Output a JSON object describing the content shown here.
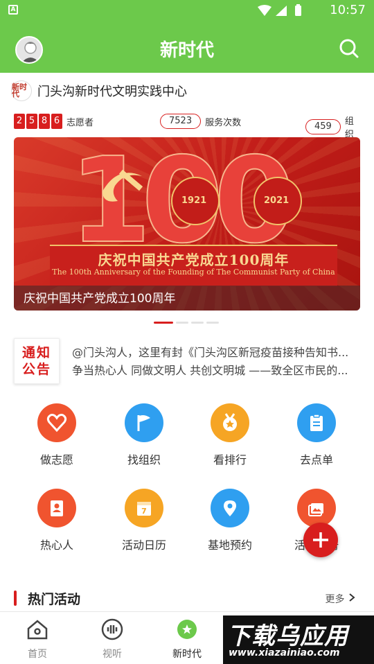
{
  "status_bar": {
    "time": "10:57"
  },
  "header": {
    "title": "新时代"
  },
  "org": {
    "name": "门头沟新时代文明实践中心",
    "logo_text": "新时代"
  },
  "stats": {
    "volunteer_digits": [
      "2",
      "5",
      "8",
      "6"
    ],
    "volunteer_label": "志愿者",
    "service_count": "7523",
    "service_label": "服务次数",
    "org_count": "459",
    "org_label": "组织"
  },
  "banner": {
    "caption": "庆祝中国共产党成立100周年",
    "image_cn": "庆祝中国共产党成立100周年",
    "image_en": "The 100th Anniversary of the Founding of The Communist Party of China",
    "year_start": "1921",
    "year_end": "2021",
    "big_number": "100",
    "slide_count": 4,
    "active_slide": 1
  },
  "notice": {
    "badge": "通知公告",
    "lines": [
      "@门头沟人，这里有封《门头沟区新冠疫苗接种告知书...",
      "争当热心人 同做文明人 共创文明城 ——致全区市民的..."
    ]
  },
  "features": [
    {
      "label": "做志愿",
      "icon": "heart-icon",
      "color": "#f0542f"
    },
    {
      "label": "找组织",
      "icon": "flag-icon",
      "color": "#2f9ff0"
    },
    {
      "label": "看排行",
      "icon": "medal-icon",
      "color": "#f6a524"
    },
    {
      "label": "去点单",
      "icon": "clipboard-icon",
      "color": "#2f9ff0"
    },
    {
      "label": "热心人",
      "icon": "person-card-icon",
      "color": "#f0542f"
    },
    {
      "label": "活动日历",
      "icon": "calendar-icon",
      "color": "#f6a524"
    },
    {
      "label": "基地预约",
      "icon": "location-pin-icon",
      "color": "#2f9ff0"
    },
    {
      "label": "活动相册",
      "icon": "photo-album-icon",
      "color": "#f0542f"
    }
  ],
  "section": {
    "title": "热门活动",
    "more": "更多"
  },
  "tabs": [
    {
      "label": "首页",
      "icon": "home-icon"
    },
    {
      "label": "视听",
      "icon": "audio-icon"
    },
    {
      "label": "新时代",
      "icon": "star-icon"
    }
  ],
  "watermark": {
    "big": "下载乌应用",
    "small": "www.xiazainiao.com"
  }
}
